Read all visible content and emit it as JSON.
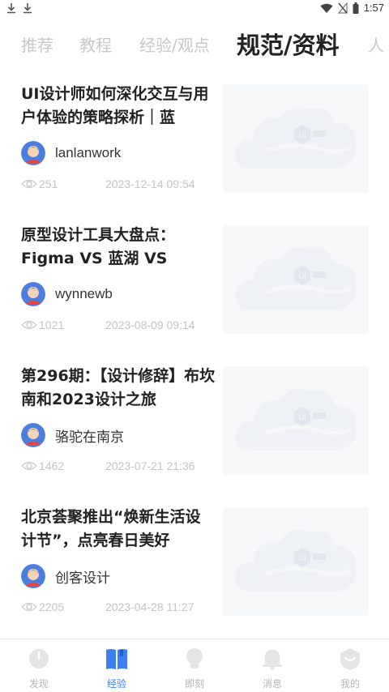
{
  "status_bar": {
    "time": "1:57"
  },
  "tabs": [
    {
      "label": "推荐",
      "active": false
    },
    {
      "label": "教程",
      "active": false
    },
    {
      "label": "经验/观点",
      "active": false
    },
    {
      "label": "规范/资料",
      "active": true
    },
    {
      "label": "人",
      "active": false
    }
  ],
  "articles": [
    {
      "title": "UI设计师如何深化交互与用户体验的策略探析｜蓝",
      "author": "lanlanwork",
      "views": "251",
      "date": "2023-12-14 09:54"
    },
    {
      "title": "原型设计工具大盘点：Figma VS 蓝湖 VS Axure",
      "author": "wynnewb",
      "views": "1021",
      "date": "2023-08-09 09:14"
    },
    {
      "title": "第296期：【设计修辞】布坎南和2023设计之旅",
      "author": "骆驼在南京",
      "views": "1462",
      "date": "2023-07-21 21:36"
    },
    {
      "title": "北京荟聚推出“焕新生活设计节”，点亮春日美好",
      "author": "创客设计",
      "views": "2205",
      "date": "2023-04-28 11:27"
    }
  ],
  "bottom_nav": [
    {
      "label": "发现",
      "icon": "discover-icon",
      "active": false
    },
    {
      "label": "经验",
      "icon": "book-icon",
      "active": true
    },
    {
      "label": "即刻",
      "icon": "bulb-icon",
      "active": false
    },
    {
      "label": "消息",
      "icon": "bell-icon",
      "active": false
    },
    {
      "label": "我的",
      "icon": "profile-shield-icon",
      "active": false
    }
  ],
  "colors": {
    "accent": "#3b7ff0",
    "inactive": "#c8c8c8",
    "title": "#222222",
    "meta": "#c4c4c4"
  }
}
